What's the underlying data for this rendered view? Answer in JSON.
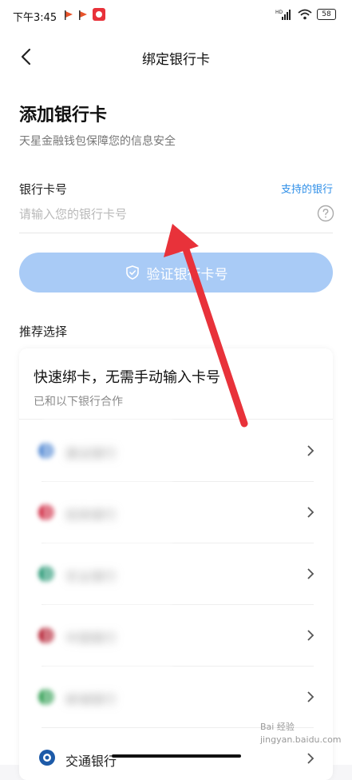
{
  "status_bar": {
    "time": "下午3:45",
    "battery": "58",
    "icons": [
      "notification-flag-icon",
      "notification-flag-icon",
      "app-notification-icon",
      "hd-signal-icon",
      "wifi-icon",
      "battery-icon"
    ]
  },
  "nav": {
    "title": "绑定银行卡",
    "back_icon": "chevron-left-icon"
  },
  "header": {
    "title": "添加银行卡",
    "subtitle": "天星金融钱包保障您的信息安全"
  },
  "form": {
    "card_label": "银行卡号",
    "support_link": "支持的银行",
    "card_placeholder": "请输入您的银行卡号",
    "card_value": "",
    "help_icon": "question-circle-icon",
    "verify_button": "验证银行卡号",
    "verify_icon": "shield-check-icon"
  },
  "recommend": {
    "section_label": "推荐选择",
    "title": "快速绑卡，无需手动输入卡号",
    "subtitle": "已和以下银行合作",
    "banks": [
      {
        "name": "建设银行",
        "color": "#5b8fd6",
        "blurred": true
      },
      {
        "name": "招商银行",
        "color": "#d2324a",
        "blurred": true
      },
      {
        "name": "农业银行",
        "color": "#2f9c7a",
        "blurred": true
      },
      {
        "name": "中国银行",
        "color": "#b8283a",
        "blurred": true
      },
      {
        "name": "邮储银行",
        "color": "#3aa35a",
        "blurred": true
      },
      {
        "name": "交通银行",
        "color": "#1d5aa8",
        "blurred": false
      }
    ]
  },
  "watermark": {
    "brand": "Bai 经验",
    "domain": "jingyan.baidu.com"
  },
  "colors": {
    "accent": "#2f8fe8",
    "button_disabled": "#a9cbf6",
    "annotation_arrow": "#e8323a"
  }
}
